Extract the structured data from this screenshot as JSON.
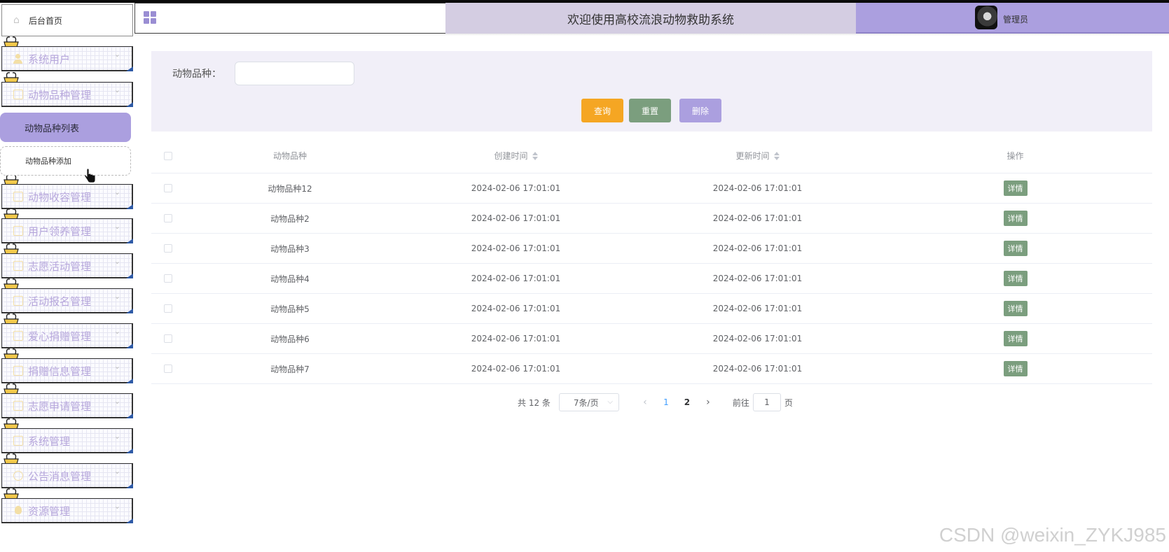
{
  "header": {
    "title": "欢迎使用高校流浪动物救助系统",
    "user": "管理员",
    "colors": {
      "title_bg": "#d4cde2",
      "user_bg": "#ab9fdf"
    }
  },
  "sidebar": {
    "home": "后台首页",
    "active_submenu": "动物品种列表",
    "hover_submenu": "动物品种添加",
    "items": [
      {
        "label": "系统用户",
        "icon": "person-icon"
      },
      {
        "label": "动物品种管理",
        "icon": "doc-icon"
      },
      {
        "label": "动物收容管理",
        "icon": "doc-icon"
      },
      {
        "label": "用户领养管理",
        "icon": "doc-icon"
      },
      {
        "label": "志愿活动管理",
        "icon": "doc-icon"
      },
      {
        "label": "活动报名管理",
        "icon": "doc-icon"
      },
      {
        "label": "爱心捐赠管理",
        "icon": "doc-icon"
      },
      {
        "label": "捐赠信息管理",
        "icon": "doc-icon"
      },
      {
        "label": "志愿申请管理",
        "icon": "doc-icon"
      },
      {
        "label": "系统管理",
        "icon": "picture-icon"
      },
      {
        "label": "公告消息管理",
        "icon": "info-icon"
      },
      {
        "label": "资源管理",
        "icon": "bulb-icon"
      }
    ]
  },
  "search": {
    "label": "动物品种：",
    "value": "",
    "buttons": {
      "query": "查询",
      "reset": "重置",
      "delete": "删除"
    },
    "colors": {
      "query": "#f5a623",
      "reset": "#7b9e7e",
      "delete": "#ab9fdf"
    }
  },
  "table": {
    "headers": {
      "name": "动物品种",
      "created": "创建时间",
      "updated": "更新时间",
      "ops": "操作"
    },
    "detail_label": "详情",
    "rows": [
      {
        "name": "动物品种12",
        "created": "2024-02-06 17:01:01",
        "updated": "2024-02-06 17:01:01"
      },
      {
        "name": "动物品种2",
        "created": "2024-02-06 17:01:01",
        "updated": "2024-02-06 17:01:01"
      },
      {
        "name": "动物品种3",
        "created": "2024-02-06 17:01:01",
        "updated": "2024-02-06 17:01:01"
      },
      {
        "name": "动物品种4",
        "created": "2024-02-06 17:01:01",
        "updated": "2024-02-06 17:01:01"
      },
      {
        "name": "动物品种5",
        "created": "2024-02-06 17:01:01",
        "updated": "2024-02-06 17:01:01"
      },
      {
        "name": "动物品种6",
        "created": "2024-02-06 17:01:01",
        "updated": "2024-02-06 17:01:01"
      },
      {
        "name": "动物品种7",
        "created": "2024-02-06 17:01:01",
        "updated": "2024-02-06 17:01:01"
      }
    ]
  },
  "pagination": {
    "total": "共 12 条",
    "page_size": "7条/页",
    "pages": [
      "1",
      "2"
    ],
    "current": "1",
    "goto_prefix": "前往",
    "goto_value": "1",
    "goto_suffix": "页"
  },
  "watermark": "CSDN @weixin_ZYKJ985"
}
